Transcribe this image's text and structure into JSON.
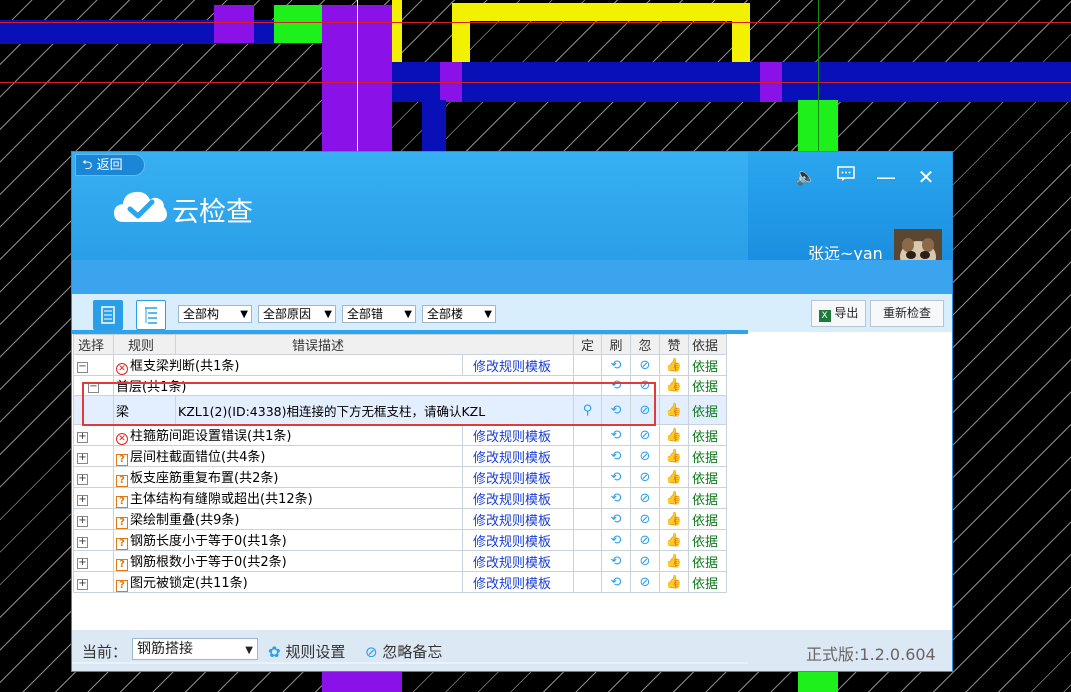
{
  "window": {
    "back_label": "返回",
    "app_title": "云检查",
    "user_name": "张远~yan"
  },
  "toolbar": {
    "dropdowns": [
      "全部构",
      "全部原因",
      "全部错",
      "全部楼"
    ],
    "export_label": "导出",
    "recheck_label": "重新检查"
  },
  "table": {
    "headers": [
      "选择",
      "规则",
      "错误描述",
      "定",
      "刷",
      "忽",
      "赞",
      "依据"
    ],
    "rows": [
      {
        "rule": "框支梁判断(共1条)",
        "desc": "修改规则模板",
        "basis": "依据"
      },
      {
        "rule": "首层(共1条)",
        "basis": "依据"
      },
      {
        "rule": "梁",
        "desc": "KZL1(2)(ID:4338)相连接的下方无框支柱，请确认KZL",
        "basis": "依据"
      },
      {
        "rule": "柱箍筋间距设置错误(共1条)",
        "desc": "修改规则模板",
        "basis": "依据"
      },
      {
        "rule": "层间柱截面错位(共4条)",
        "desc": "修改规则模板",
        "basis": "依据"
      },
      {
        "rule": "板支座筋重复布置(共2条)",
        "desc": "修改规则模板",
        "basis": "依据"
      },
      {
        "rule": "主体结构有缝隙或超出(共12条)",
        "desc": "修改规则模板",
        "basis": "依据"
      },
      {
        "rule": "梁绘制重叠(共9条)",
        "desc": "修改规则模板",
        "basis": "依据"
      },
      {
        "rule": "钢筋长度小于等于0(共1条)",
        "desc": "修改规则模板",
        "basis": "依据"
      },
      {
        "rule": "钢筋根数小于等于0(共2条)",
        "desc": "修改规则模板",
        "basis": "依据"
      },
      {
        "rule": "图元被锁定(共11条)",
        "desc": "修改规则模板",
        "basis": "依据"
      }
    ]
  },
  "footer": {
    "current_label": "当前：",
    "current_value": "钢筋搭接",
    "rule_settings": "规则设置",
    "ignore_memo": "忽略备忘",
    "version": "正式版:1.2.0.604"
  },
  "colors": {
    "header_blue": "#2aa6ee",
    "link_blue": "#1a3ed6",
    "basis_green": "#0f7a1e",
    "highlight_red": "#e03b3b"
  }
}
